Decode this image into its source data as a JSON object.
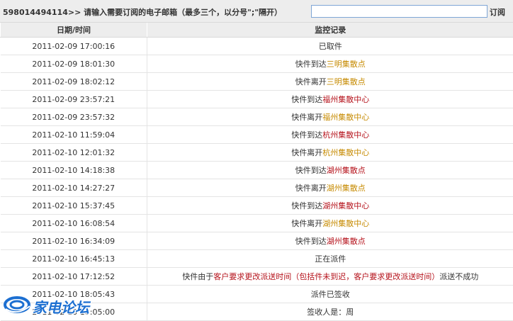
{
  "subscribe": {
    "prompt": "598014494114>> 请输入需要订阅的电子邮箱（最多三个，以分号\";\"隔开）",
    "input_value": "",
    "button_label": "订阅"
  },
  "table": {
    "headers": {
      "time": "日期/时间",
      "record": "监控记录"
    },
    "rows": [
      {
        "time": "2011-02-09 17:00:16",
        "pre": "已取件",
        "loc": "",
        "post": ""
      },
      {
        "time": "2011-02-09 18:01:30",
        "pre": "快件到达",
        "loc": "三明集散点",
        "post": ""
      },
      {
        "time": "2011-02-09 18:02:12",
        "pre": "快件离开",
        "loc": "三明集散点",
        "post": ""
      },
      {
        "time": "2011-02-09 23:57:21",
        "pre": "快件到达",
        "loc": "福州集散中心",
        "post": ""
      },
      {
        "time": "2011-02-09 23:57:32",
        "pre": "快件离开",
        "loc": "福州集散中心",
        "post": ""
      },
      {
        "time": "2011-02-10 11:59:04",
        "pre": "快件到达",
        "loc": "杭州集散中心",
        "post": ""
      },
      {
        "time": "2011-02-10 12:01:32",
        "pre": "快件离开",
        "loc": "杭州集散中心",
        "post": ""
      },
      {
        "time": "2011-02-10 14:18:38",
        "pre": "快件到达",
        "loc": "湖州集散点",
        "post": ""
      },
      {
        "time": "2011-02-10 14:27:27",
        "pre": "快件离开",
        "loc": "湖州集散点",
        "post": ""
      },
      {
        "time": "2011-02-10 15:37:45",
        "pre": "快件到达",
        "loc": "湖州集散中心",
        "post": ""
      },
      {
        "time": "2011-02-10 16:08:54",
        "pre": "快件离开",
        "loc": "湖州集散中心",
        "post": ""
      },
      {
        "time": "2011-02-10 16:34:09",
        "pre": "快件到达",
        "loc": "湖州集散点",
        "post": ""
      },
      {
        "time": "2011-02-10 16:45:13",
        "pre": "正在派件",
        "loc": "",
        "post": ""
      },
      {
        "time": "2011-02-10 17:12:52",
        "pre": "快件由于",
        "loc": "客户要求更改派送时间（包括件未到迟，客户要求更改派送时间）",
        "post": "派送不成功"
      },
      {
        "time": "2011-02-10 18:05:43",
        "pre": "派件已签收",
        "loc": "",
        "post": ""
      },
      {
        "time": "2011-02-10 18:05:00",
        "pre": "签收人是：周",
        "loc": "",
        "post": ""
      }
    ]
  },
  "colors": {
    "loc_yellow": "#c68a00",
    "loc_red": "#b5121b",
    "header_bg": "#ededed",
    "watermark_blue": "#1c6fd1"
  },
  "watermark": {
    "text": "家电论坛",
    "icon": "swirl-logo-icon"
  }
}
